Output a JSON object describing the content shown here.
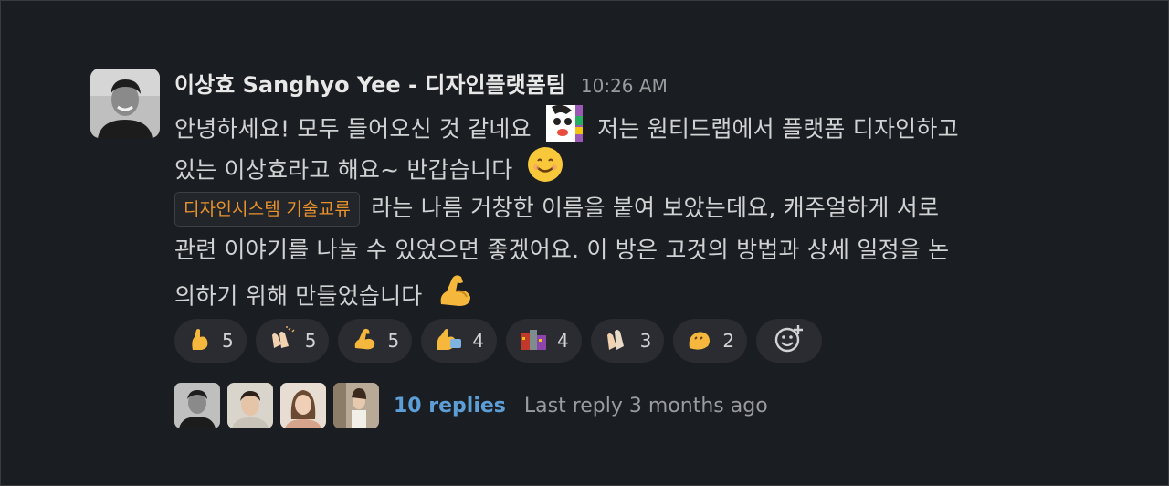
{
  "message": {
    "sender": "이상효 Sanghyo Yee - 디자인플랫폼팀",
    "timestamp": "10:26 AM",
    "line1_a": "안녕하세요! 모두 들어오신 것 같네요",
    "line1_b": "저는 원티드랩에서 플랫폼 디자인하고",
    "line2": "있는 이상효라고 해요~ 반갑습니다",
    "chip": "디자인시스템  기술교류",
    "line3": "라는 나름 거창한 이름을 붙여 보았는데요, 캐주얼하게 서로",
    "line4": "관련 이야기를 나눌 수 있었으면 좋겠어요. 이 방은 고것의 방법과 상세 일정을 논",
    "line5": "의하기 위해 만들었습니다",
    "emojis": [
      "clown-face",
      "smiling-face",
      "flexed-biceps"
    ]
  },
  "reactions": [
    {
      "icon": "raised-hand-emoji",
      "count": "5"
    },
    {
      "icon": "clapping-hands-emoji",
      "count": "5"
    },
    {
      "icon": "flexed-biceps-emoji",
      "count": "5"
    },
    {
      "icon": "waving-hand-emoji",
      "count": "4"
    },
    {
      "icon": "building-emoji",
      "count": "4"
    },
    {
      "icon": "clap-emoji",
      "count": "3"
    },
    {
      "icon": "wave-emoji",
      "count": "2"
    }
  ],
  "add_reaction_icon": "add-reaction-icon",
  "thread": {
    "replies": "10 replies",
    "last_reply": "Last reply 3 months ago"
  },
  "colors": {
    "background": "#1a1d21",
    "link": "#5d9ed6",
    "chip_text": "#e8912d"
  }
}
